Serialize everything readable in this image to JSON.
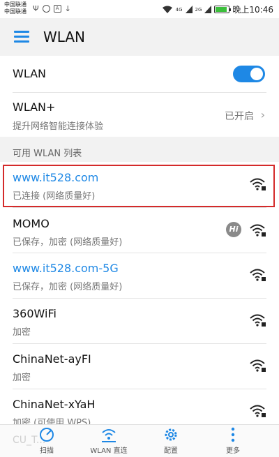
{
  "status_bar": {
    "carrier_1": "中国联通",
    "carrier_2": "中国联通",
    "signal_label_1": "4G",
    "signal_label_2": "2G",
    "time": "晚上10:46"
  },
  "app_bar": {
    "title": "WLAN"
  },
  "wlan_switch": {
    "label": "WLAN",
    "on": true
  },
  "wlan_plus": {
    "title": "WLAN+",
    "subtitle": "提升网络智能连接体验",
    "status": "已开启"
  },
  "section_label": "可用 WLAN 列表",
  "networks": [
    {
      "name": "www.it528.com",
      "status": "已连接 (网络质量好)",
      "connected": true
    },
    {
      "name": "MOMO",
      "status": "已保存，加密 (网络质量好)",
      "badge": "Hi"
    },
    {
      "name": "www.it528.com-5G",
      "status": "已保存，加密 (网络质量好)"
    },
    {
      "name": "360WiFi",
      "status": "加密"
    },
    {
      "name": "ChinaNet-ayFI",
      "status": "加密"
    },
    {
      "name": "ChinaNet-xYaH",
      "status": "加密 (可使用 WPS)"
    }
  ],
  "partial_network": "CU_T...",
  "bottom_nav": {
    "scan": "扫描",
    "wlan_direct": "WLAN 直连",
    "config": "配置",
    "more": "更多"
  },
  "colors": {
    "accent": "#1e88e5",
    "highlight": "#d42a2a"
  }
}
